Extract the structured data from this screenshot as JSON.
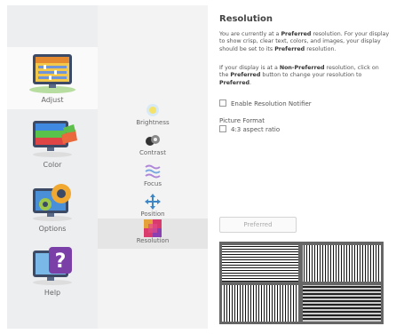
{
  "categories": [
    {
      "label": "Adjust",
      "icon": "adjust-icon"
    },
    {
      "label": "Color",
      "icon": "color-icon"
    },
    {
      "label": "Options",
      "icon": "options-icon"
    },
    {
      "label": "Help",
      "icon": "help-icon"
    }
  ],
  "subitems": [
    {
      "label": "Brightness",
      "icon": "brightness-icon"
    },
    {
      "label": "Contrast",
      "icon": "contrast-icon"
    },
    {
      "label": "Focus",
      "icon": "focus-icon"
    },
    {
      "label": "Position",
      "icon": "position-icon"
    },
    {
      "label": "Resolution",
      "icon": "resolution-icon"
    }
  ],
  "content": {
    "title": "Resolution",
    "para1": {
      "a": "You are currently at a ",
      "b": "Preferred",
      "c": " resolution. For your display to show crisp, clear text, colors, and images, your display should be set to its ",
      "d": "Preferred",
      "e": " resolution."
    },
    "para2": {
      "a": "If your display is at a ",
      "b": "Non-Preferred",
      "c": " resolution, click on the ",
      "d": "Preferred",
      "e": " button to change your resolution to ",
      "f": "Preferred",
      "g": "."
    },
    "enable_notifier_label": "Enable Resolution Notifier",
    "picture_format_label": "Picture Format",
    "aspect_label": "4:3 aspect ratio",
    "preferred_button": "Preferred"
  },
  "active_category": "Adjust",
  "active_subitem": "Resolution",
  "colors": {
    "accent_active_category_bg": "#fafafa",
    "test_pattern_bg": "#666666"
  }
}
